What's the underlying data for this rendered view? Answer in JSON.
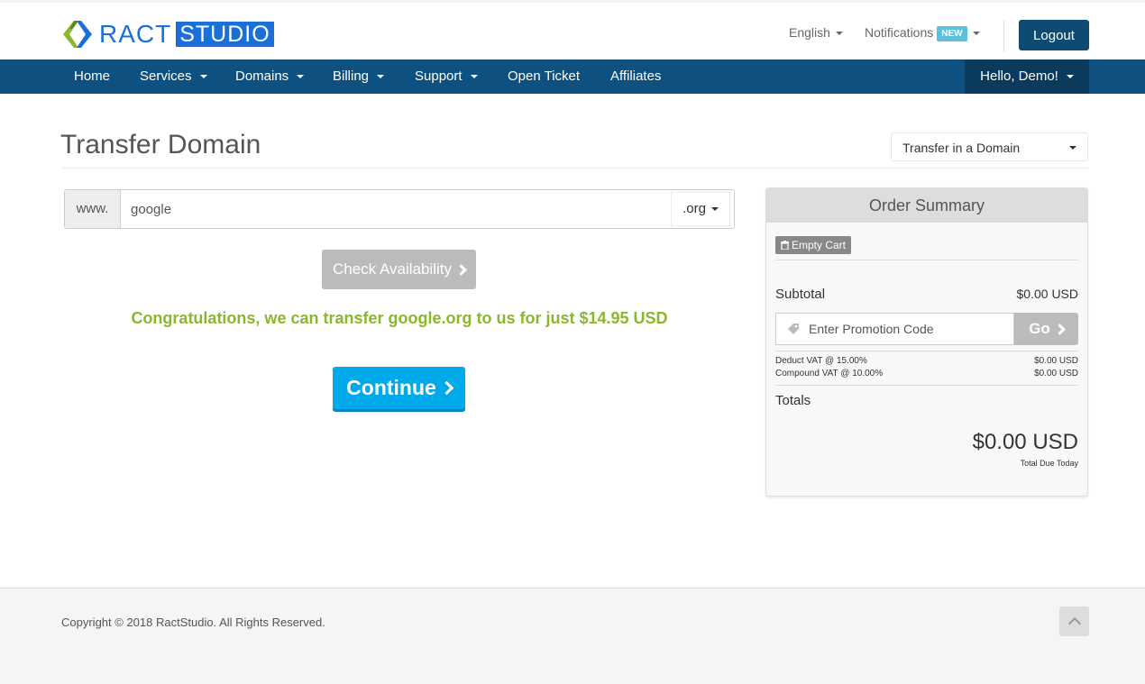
{
  "brand": {
    "name_part1": "RACT",
    "name_part2": "STUDIO",
    "color": "#1a6fd8"
  },
  "header": {
    "language": "English",
    "notifications": "Notifications",
    "notifications_badge": "NEW",
    "logout": "Logout"
  },
  "nav": {
    "items": [
      {
        "label": "Home",
        "dropdown": false
      },
      {
        "label": "Services",
        "dropdown": true
      },
      {
        "label": "Domains",
        "dropdown": true
      },
      {
        "label": "Billing",
        "dropdown": true
      },
      {
        "label": "Support",
        "dropdown": true
      },
      {
        "label": "Open Ticket",
        "dropdown": false
      },
      {
        "label": "Affiliates",
        "dropdown": false
      }
    ],
    "user_menu": "Hello, Demo!"
  },
  "page": {
    "title": "Transfer Domain",
    "category_select": "Transfer in a Domain"
  },
  "domain_form": {
    "prefix": "www.",
    "domain_value": "google",
    "tld": ".org",
    "check_button": "Check Availability",
    "result_message": "Congratulations, we can transfer google.org to us for just $14.95 USD",
    "continue_button": "Continue",
    "success_color": "#8bb82b",
    "continue_color": "#00a9ea"
  },
  "order_summary": {
    "heading": "Order Summary",
    "empty_cart": "Empty Cart",
    "subtotal_label": "Subtotal",
    "subtotal_value": "$0.00 USD",
    "promo_placeholder": "Enter Promotion Code",
    "promo_button": "Go",
    "taxes": [
      {
        "label": "Deduct VAT @ 15.00%",
        "value": "$0.00 USD"
      },
      {
        "label": "Compound VAT @ 10.00%",
        "value": "$0.00 USD"
      }
    ],
    "totals_label": "Totals",
    "total_value": "$0.00 USD",
    "total_caption": "Total Due Today"
  },
  "footer": {
    "copyright": "Copyright © 2018 RactStudio. All Rights Reserved."
  }
}
